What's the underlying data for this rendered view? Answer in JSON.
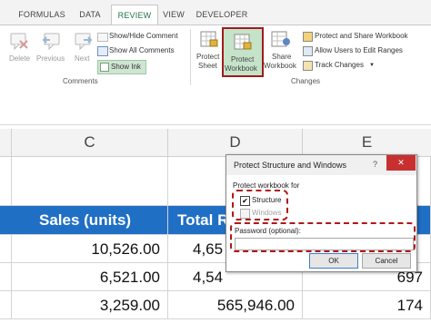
{
  "tabs": [
    {
      "label": "FORMULAS",
      "active": false
    },
    {
      "label": "DATA",
      "active": false
    },
    {
      "label": "REVIEW",
      "active": true
    },
    {
      "label": "VIEW",
      "active": false
    },
    {
      "label": "DEVELOPER",
      "active": false
    }
  ],
  "comments_group": {
    "label": "Comments",
    "delete": "Delete",
    "previous": "Previous",
    "next": "Next",
    "show_hide": "Show/Hide Comment",
    "show_all": "Show All Comments",
    "show_ink": "Show Ink"
  },
  "changes_group": {
    "label": "Changes",
    "protect_sheet": [
      "Protect",
      "Sheet"
    ],
    "protect_workbook": [
      "Protect",
      "Workbook"
    ],
    "share_workbook": [
      "Share",
      "Workbook"
    ],
    "protect_share": "Protect and Share Workbook",
    "allow_users": "Allow Users to Edit Ranges",
    "track_changes": "Track Changes"
  },
  "columns": {
    "c": "C",
    "d": "D",
    "e": "E"
  },
  "table": {
    "header_c": "Sales (units)",
    "header_d": "Total R",
    "rows": [
      {
        "c": "10,526.00",
        "d": "4,65",
        "e": ""
      },
      {
        "c": "6,521.00",
        "d": "4,54",
        "e": "697"
      },
      {
        "c": "3,259.00",
        "d": "565,946.00",
        "e": "174"
      }
    ]
  },
  "dialog": {
    "title": "Protect Structure and Windows",
    "help": "?",
    "close": "✕",
    "protect_for": "Protect workbook for",
    "structure": "Structure",
    "windows": "Windows",
    "password_label": "Password (optional):",
    "ok": "OK",
    "cancel": "Cancel"
  },
  "colors": {
    "accent": "#217346",
    "header_fill": "#1f6fc5",
    "highlight": "#b01818",
    "close_red": "#c8302f"
  }
}
